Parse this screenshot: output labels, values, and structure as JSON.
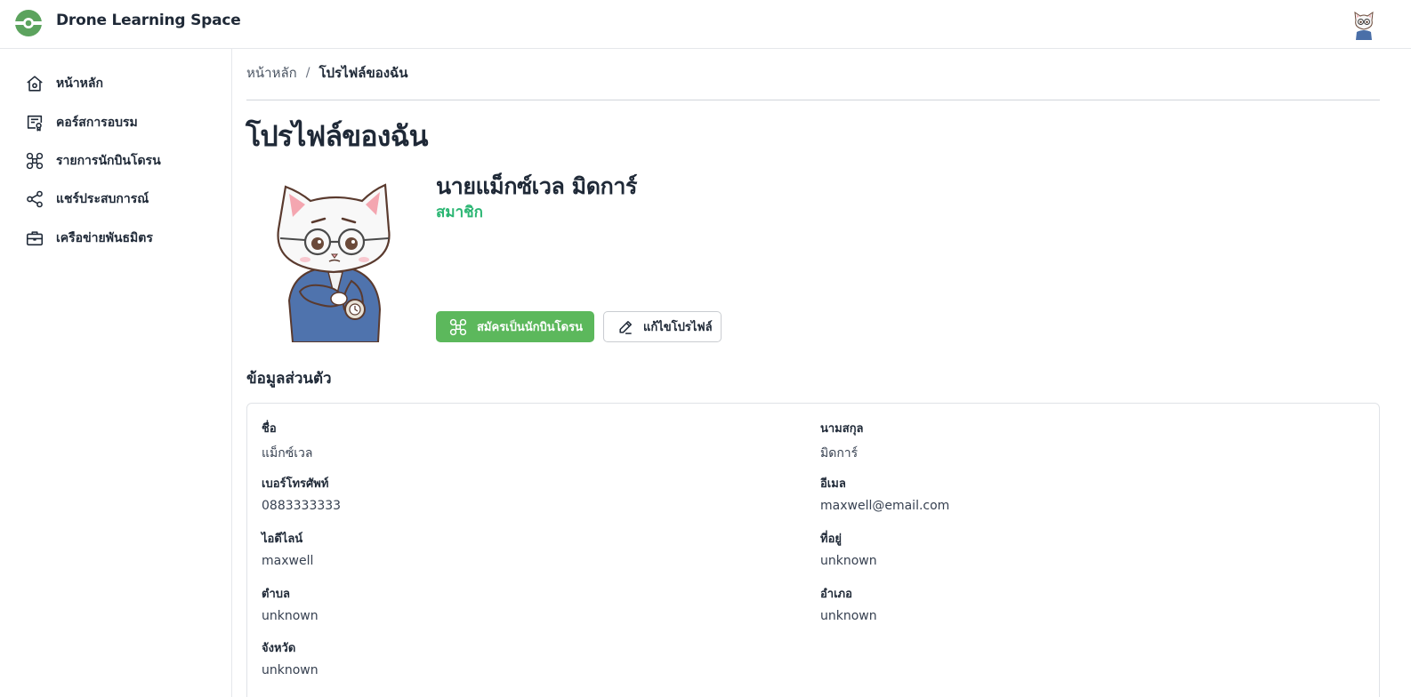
{
  "app": {
    "name": "Drone Learning Space"
  },
  "sidebar": {
    "items": [
      {
        "label": "หน้าหลัก",
        "icon": "home-icon"
      },
      {
        "label": "คอร์สการอบรม",
        "icon": "certificate-icon"
      },
      {
        "label": "รายการนักบินโดรน",
        "icon": "drone-icon"
      },
      {
        "label": "แชร์ประสบการณ์",
        "icon": "share-icon"
      },
      {
        "label": "เครือข่ายพันธมิตร",
        "icon": "briefcase-icon"
      }
    ]
  },
  "breadcrumb": {
    "home": "หน้าหลัก",
    "separator": "/",
    "current": "โปรไฟล์ของฉัน"
  },
  "page": {
    "title": "โปรไฟล์ของฉัน"
  },
  "profile": {
    "full_name": "นายแม็กซ์เวล มิดการ์",
    "role": "สมาชิก",
    "register_button": "สมัครเป็นนักบินโดรน",
    "edit_button": "แก้ไขโปรไฟล์"
  },
  "personal_info": {
    "title": "ข้อมูลส่วนตัว",
    "fields": [
      {
        "label": "ชื่อ",
        "value": "แม็กซ์เวล"
      },
      {
        "label": "นามสกุล",
        "value": "มิดการ์"
      },
      {
        "label": "เบอร์โทรศัพท์",
        "value": "0883333333"
      },
      {
        "label": "อีเมล",
        "value": "maxwell@email.com"
      },
      {
        "label": "ไอดีไลน์",
        "value": "maxwell"
      },
      {
        "label": "ที่อยู่",
        "value": "unknown"
      },
      {
        "label": "ตำบล",
        "value": "unknown"
      },
      {
        "label": "อำเภอ",
        "value": "unknown"
      },
      {
        "label": "จังหวัด",
        "value": "unknown"
      }
    ]
  },
  "colors": {
    "brand": "#5ca35e",
    "primary_button": "#5cb85c",
    "role_text": "#2bb673"
  }
}
